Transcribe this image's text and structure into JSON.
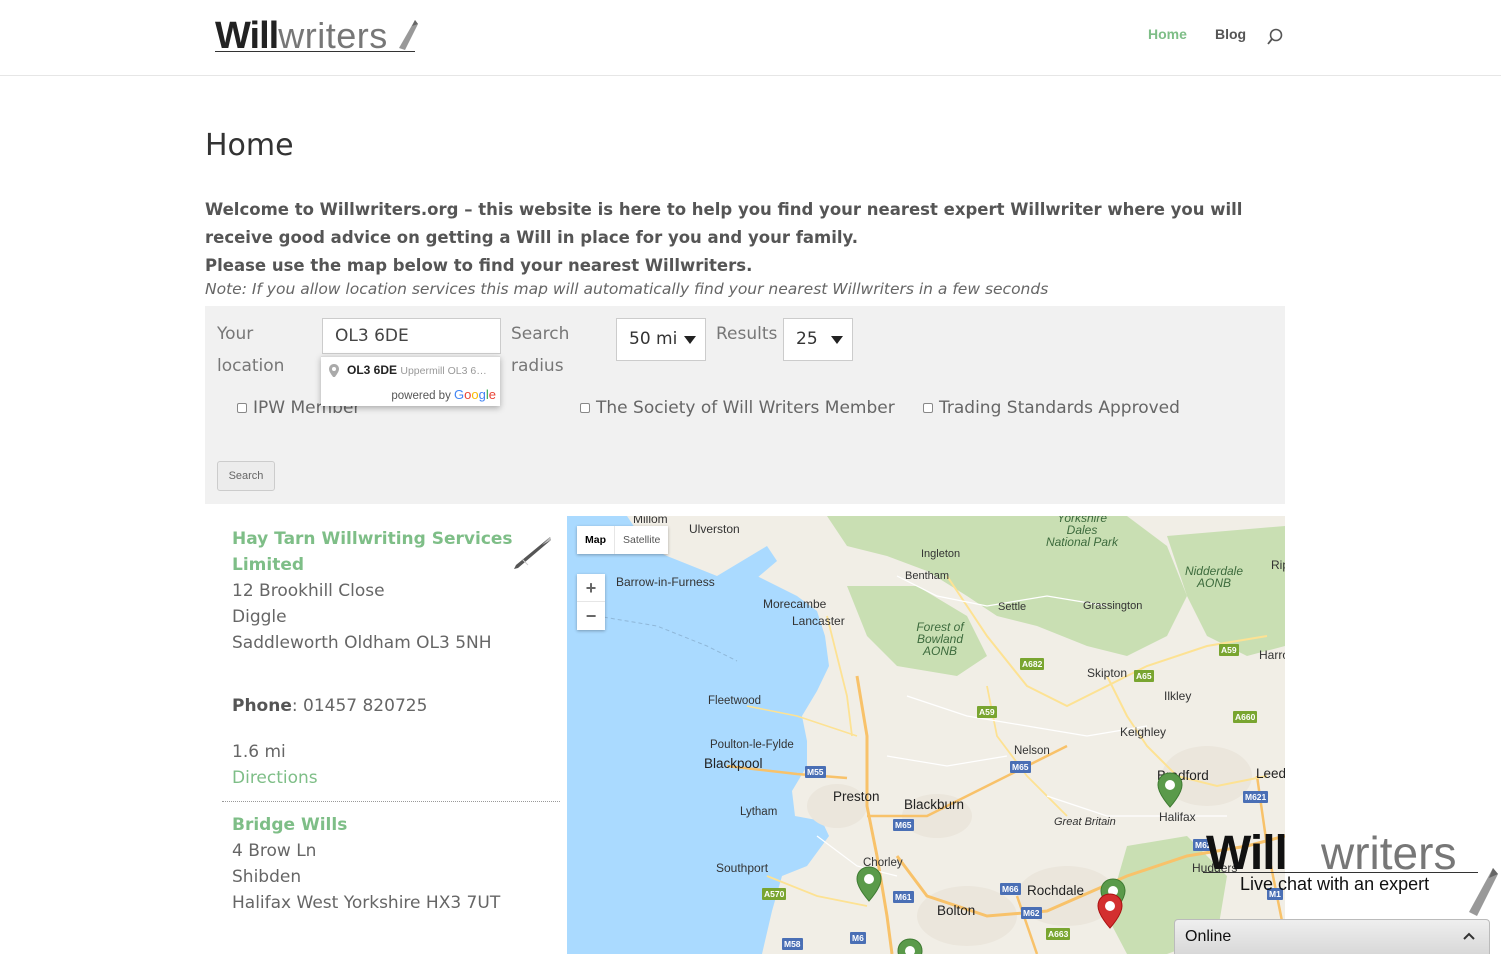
{
  "header": {
    "logo_bold": "Will",
    "logo_light": "writers",
    "nav": [
      {
        "label": "Home",
        "active": true
      },
      {
        "label": "Blog",
        "active": false
      }
    ],
    "search_icon": "search-icon"
  },
  "page": {
    "title": "Home",
    "intro_line1": "Welcome to Willwriters.org – this website is here to help you find your nearest expert Willwriter where you will receive good advice on getting a Will in place for you and your family.",
    "intro_line2": "Please use the map below to find your nearest Willwriters.",
    "note": "Note: If you allow location services this map will automatically find your nearest Willwriters in a few seconds"
  },
  "search_form": {
    "location_label_1": "Your",
    "location_label_2": "location",
    "location_value": "OL3 6DE",
    "radius_label_1": "Search",
    "radius_label_2": "radius",
    "radius_value": "50 mi",
    "results_label": "Results",
    "results_value": "25",
    "autocomplete": {
      "main": "OL3 6DE",
      "secondary": "Uppermill OL3 6…",
      "powered_by": "powered by",
      "google": [
        "G",
        "o",
        "o",
        "g",
        "l",
        "e"
      ]
    },
    "filters": [
      {
        "label": "IPW Member",
        "checked": false
      },
      {
        "label": "The Society of Will Writers Member",
        "checked": false
      },
      {
        "label": "Trading Standards Approved",
        "checked": false
      }
    ],
    "search_button": "Search"
  },
  "listings": [
    {
      "name_line1": "Hay Tarn Willwriting Services",
      "name_line2": "Limited",
      "address": [
        "12 Brookhill Close",
        "Diggle",
        "Saddleworth Oldham OL3 5NH"
      ],
      "phone_label": "Phone",
      "phone": ": 01457 820725",
      "distance": "1.6 mi",
      "directions": "Directions"
    },
    {
      "name": "Bridge Wills",
      "address": [
        "4 Brow Ln",
        "Shibden",
        "Halifax West Yorkshire HX3 7UT"
      ]
    }
  ],
  "map": {
    "type_map": "Map",
    "type_satellite": "Satellite",
    "zoom_in": "+",
    "zoom_out": "−",
    "places": {
      "millom": "Millom",
      "ulverston": "Ulverston",
      "barrow": "Barrow-in-Furness",
      "morecambe": "Morecambe",
      "lancaster": "Lancaster",
      "ingleton": "Ingleton",
      "bentham": "Bentham",
      "settle": "Settle",
      "grassington": "Grassington",
      "fleetwood": "Fleetwood",
      "poulton": "Poulton-le-Fylde",
      "blackpool": "Blackpool",
      "preston": "Preston",
      "blackburn": "Blackburn",
      "lytham": "Lytham",
      "southport": "Southport",
      "chorley": "Chorley",
      "bolton": "Bolton",
      "rochdale": "Rochdale",
      "nelson": "Nelson",
      "skipton": "Skipton",
      "ilkley": "Ilkley",
      "keighley": "Keighley",
      "bradford": "Bradford",
      "leeds": "Leed",
      "halifax": "Halifax",
      "huddersfield": "Hudders",
      "great_britain": "Great Britain",
      "harrogate": "Harro",
      "ripon": "Rip"
    },
    "parks": {
      "dales_1": "Yorkshire",
      "dales_2": "Dales",
      "dales_3": "National Park",
      "bowland_1": "Forest of",
      "bowland_2": "Bowland",
      "bowland_3": "AONB",
      "nidderdale_1": "Nidderdale",
      "nidderdale_2": "AONB"
    },
    "roads": {
      "m55": "M55",
      "m65a": "M65",
      "m65b": "M65",
      "m6a": "M6",
      "m61": "M61",
      "m58": "M58",
      "m66": "M66",
      "m62a": "M62",
      "m62b": "M62",
      "m621": "M621",
      "m1": "M1",
      "a682": "A682",
      "a65": "A65",
      "a59a": "A59",
      "a59b": "A59",
      "a660": "A660",
      "a570": "A570",
      "a663": "A663"
    },
    "pin_green": "#5a9a4a",
    "pin_red": "#d32f2f"
  },
  "chat": {
    "logo_bold": "Will",
    "logo_light": "writers",
    "tagline": "Live chat with an expert",
    "status": "Online"
  },
  "colors": {
    "accent": "#7ebe87",
    "form_bg": "#f1f1f1",
    "water": "#aadaff"
  }
}
